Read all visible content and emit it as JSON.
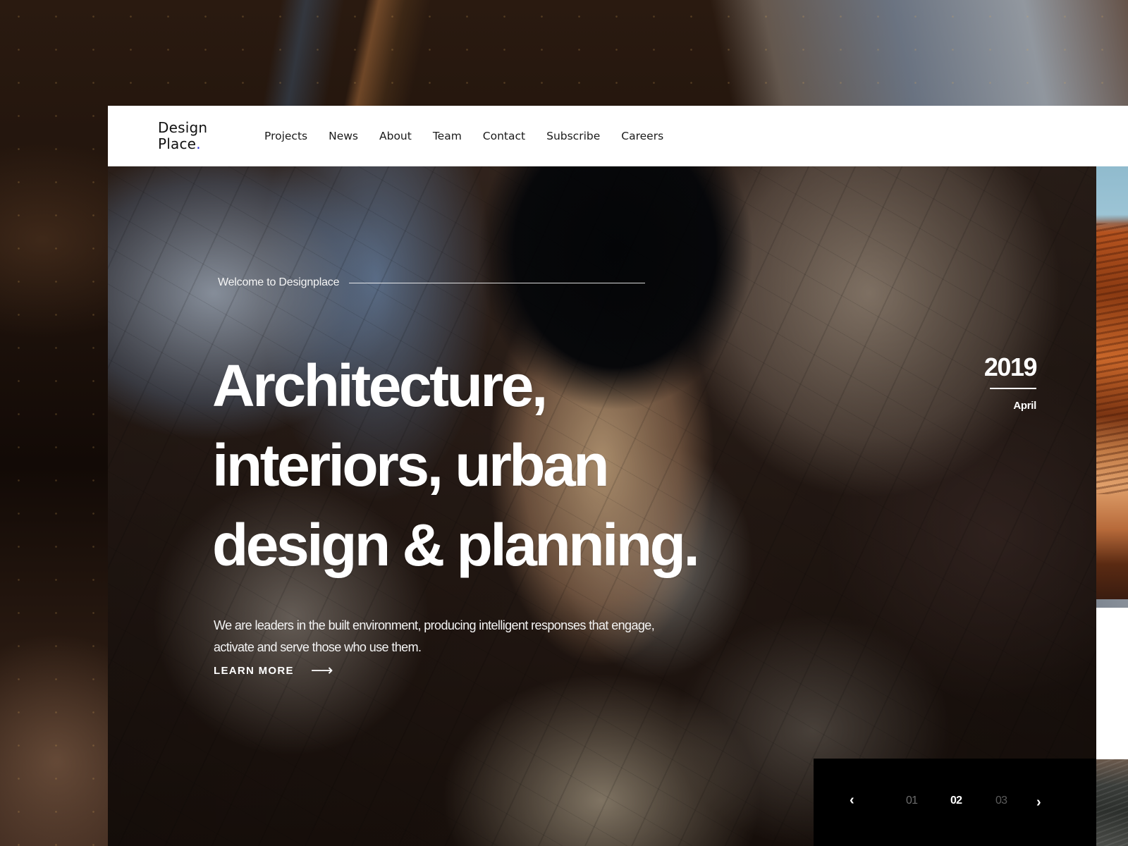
{
  "brand": {
    "line1": "Design",
    "line2": "Place",
    "dot": ".",
    "accent_color": "#2b2bd6"
  },
  "nav": {
    "items": [
      {
        "label": "Projects"
      },
      {
        "label": "News"
      },
      {
        "label": "About"
      },
      {
        "label": "Team"
      },
      {
        "label": "Contact"
      },
      {
        "label": "Subscribe"
      },
      {
        "label": "Careers"
      }
    ]
  },
  "hero": {
    "eyebrow": "Welcome to Designplace",
    "headline_lines": [
      "Architecture,",
      "interiors, urban",
      "design & planning."
    ],
    "lead": "We are leaders in the built environment, producing intelligent responses that engage, activate and serve those who use them.",
    "cta_label": "LEARN MORE",
    "cta_icon": "arrow-right-icon",
    "date": {
      "year": "2019",
      "month": "April"
    }
  },
  "slider": {
    "prev_icon": "chevron-left-icon",
    "next_icon": "chevron-right-icon",
    "slides": [
      "01",
      "02",
      "03"
    ],
    "active": "02"
  }
}
